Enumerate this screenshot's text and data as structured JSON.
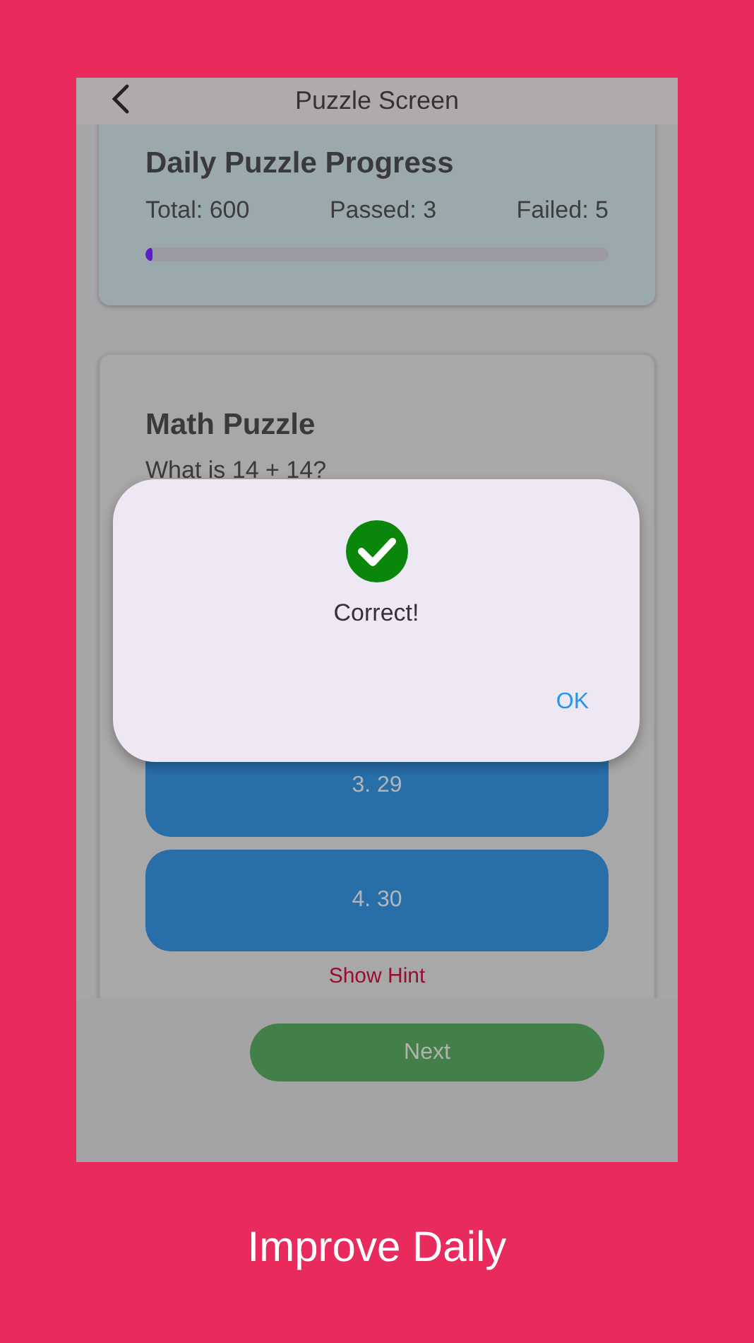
{
  "app_bar": {
    "title": "Puzzle Screen"
  },
  "progress": {
    "title": "Daily Puzzle Progress",
    "total": "Total: 600",
    "passed": "Passed: 3",
    "failed": "Failed: 5",
    "level": 0.015
  },
  "puzzle": {
    "title": "Math Puzzle",
    "question": "What is 14 + 14?",
    "options": [
      {
        "label": "3. 29"
      },
      {
        "label": "4. 30"
      }
    ],
    "hint_link": "Show Hint"
  },
  "next_button": "Next",
  "dialog": {
    "message": "Correct!",
    "ok": "OK"
  },
  "caption": "Improve Daily"
}
